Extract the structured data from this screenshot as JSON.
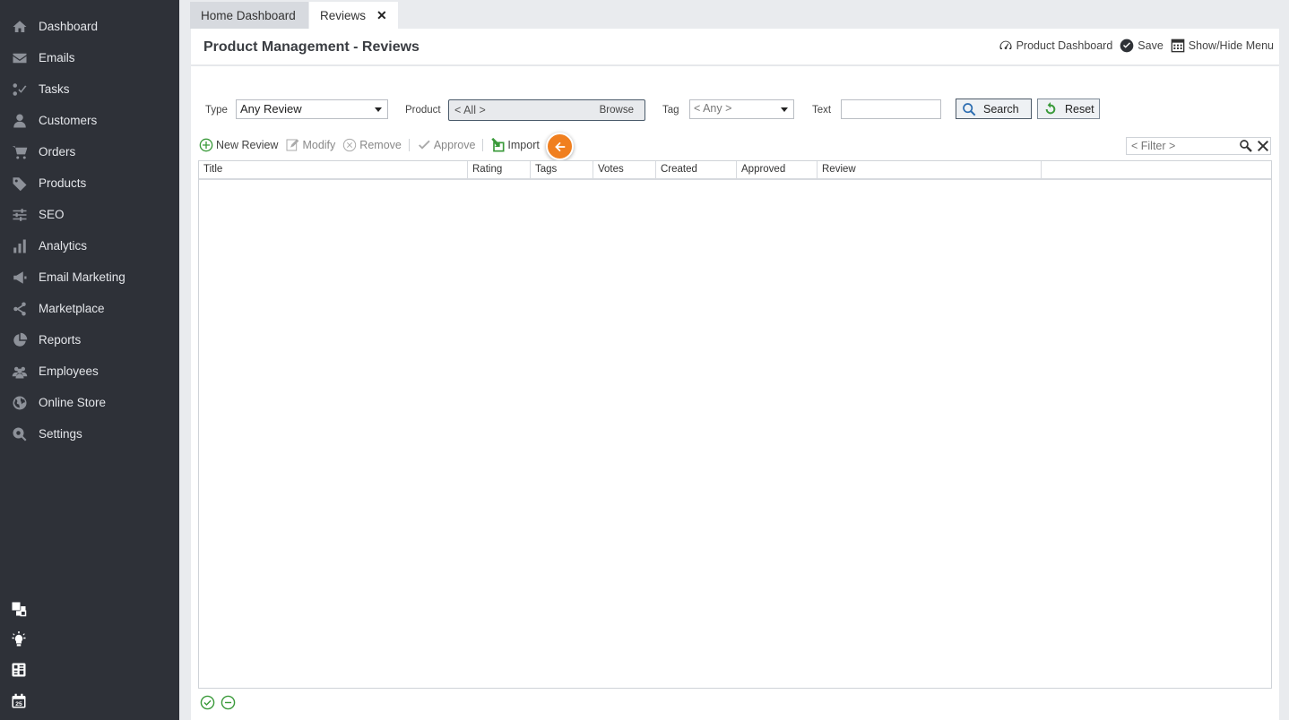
{
  "sidebar": {
    "items": [
      {
        "label": "Dashboard",
        "icon": "home-icon"
      },
      {
        "label": "Emails",
        "icon": "envelope-icon"
      },
      {
        "label": "Tasks",
        "icon": "tasks-icon"
      },
      {
        "label": "Customers",
        "icon": "user-icon"
      },
      {
        "label": "Orders",
        "icon": "cart-icon"
      },
      {
        "label": "Products",
        "icon": "tag-icon"
      },
      {
        "label": "SEO",
        "icon": "sliders-icon"
      },
      {
        "label": "Analytics",
        "icon": "bar-chart-icon"
      },
      {
        "label": "Email Marketing",
        "icon": "megaphone-icon"
      },
      {
        "label": "Marketplace",
        "icon": "share-icon"
      },
      {
        "label": "Reports",
        "icon": "pie-chart-icon"
      },
      {
        "label": "Employees",
        "icon": "users-icon"
      },
      {
        "label": "Online Store",
        "icon": "globe-icon"
      },
      {
        "label": "Settings",
        "icon": "settings-icon"
      }
    ],
    "bottom_icons": [
      "windows-icon",
      "lightbulb-icon",
      "grid-app-icon",
      "calendar-icon"
    ],
    "calendar_day": "25"
  },
  "tabs": [
    {
      "label": "Home Dashboard",
      "active": false
    },
    {
      "label": "Reviews",
      "active": true,
      "closable": true
    }
  ],
  "header": {
    "title": "Product Management - Reviews",
    "actions": {
      "product_dashboard": "Product Dashboard",
      "save": "Save",
      "show_hide_menu": "Show/Hide Menu"
    }
  },
  "search": {
    "type_label": "Type",
    "type_value": "Any Review",
    "product_label": "Product",
    "product_value": "< All >",
    "browse_label": "Browse",
    "tag_label": "Tag",
    "tag_value": "< Any >",
    "text_label": "Text",
    "text_value": "",
    "search_button": "Search",
    "reset_button": "Reset"
  },
  "toolbar": {
    "new_review": "New Review",
    "modify": "Modify",
    "remove": "Remove",
    "approve": "Approve",
    "import": "Import"
  },
  "filter": {
    "placeholder": "< Filter >"
  },
  "grid": {
    "columns": [
      "Title",
      "Rating",
      "Tags",
      "Votes",
      "Created",
      "Approved",
      "Review"
    ],
    "rows": []
  },
  "colors": {
    "sidebar_bg": "#2e3138",
    "accent_green": "#3a9a3a",
    "hint_orange": "#f07f1f"
  }
}
